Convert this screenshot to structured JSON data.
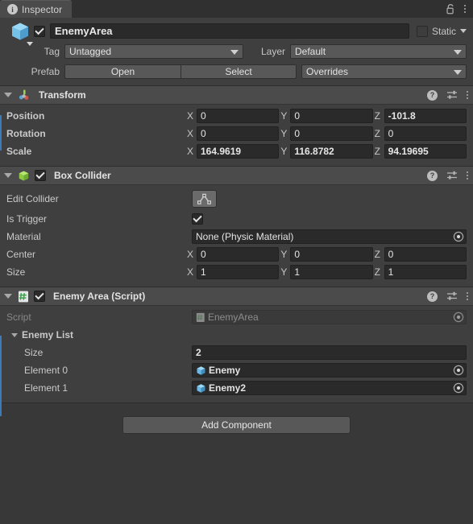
{
  "window": {
    "tab_label": "Inspector",
    "tab_icon": "info-icon",
    "lock_icon": "lock-open-icon",
    "menu_icon": "kebab-menu-icon"
  },
  "gameobject": {
    "icon": "cube-icon",
    "enabled": true,
    "name": "EnemyArea",
    "static_checked": false,
    "static_label": "Static",
    "tag_label": "Tag",
    "tag_value": "Untagged",
    "layer_label": "Layer",
    "layer_value": "Default",
    "prefab_label": "Prefab",
    "prefab_open": "Open",
    "prefab_select": "Select",
    "prefab_overrides": "Overrides"
  },
  "components": [
    {
      "id": "transform",
      "title": "Transform",
      "icon": "transform-axis-icon",
      "has_enable_checkbox": false,
      "help_icon": "help-icon",
      "preset_icon": "preset-icon",
      "menu_icon": "kebab-menu-icon",
      "rows": [
        {
          "label": "Position",
          "type": "vector3",
          "x": "0",
          "y": "0",
          "z": "-101.8",
          "bold_values": false
        },
        {
          "label": "Rotation",
          "type": "vector3",
          "x": "0",
          "y": "0",
          "z": "0",
          "bold_values": false
        },
        {
          "label": "Scale",
          "type": "vector3",
          "x": "164.9619",
          "y": "116.8782",
          "z": "94.19695",
          "bold_values": true
        }
      ]
    },
    {
      "id": "box-collider",
      "title": "Box Collider",
      "icon": "green-cube-icon",
      "has_enable_checkbox": true,
      "enabled": true,
      "help_icon": "help-icon",
      "preset_icon": "preset-icon",
      "menu_icon": "kebab-menu-icon",
      "rows": [
        {
          "label": "Edit Collider",
          "type": "button",
          "button_icon": "edit-collider-icon"
        },
        {
          "label": "Is Trigger",
          "type": "checkbox",
          "checked": true
        },
        {
          "label": "Material",
          "type": "object",
          "value": "None (Physic Material)",
          "icon": null,
          "picker": "object-picker-icon"
        },
        {
          "label": "Center",
          "type": "vector3",
          "x": "0",
          "y": "0",
          "z": "0",
          "bold_values": false
        },
        {
          "label": "Size",
          "type": "vector3",
          "x": "1",
          "y": "1",
          "z": "1",
          "bold_values": false
        }
      ]
    },
    {
      "id": "enemy-area-script",
      "title": "Enemy Area (Script)",
      "icon": "script-icon",
      "has_enable_checkbox": true,
      "enabled": true,
      "help_icon": "help-icon",
      "preset_icon": "preset-icon",
      "menu_icon": "kebab-menu-icon",
      "rows": [
        {
          "label": "Script",
          "type": "object",
          "value": "EnemyArea",
          "icon": "script-chip-icon",
          "picker": "object-picker-icon",
          "disabled": true
        },
        {
          "label": "Enemy List",
          "type": "foldout",
          "expanded": true
        },
        {
          "label": "Size",
          "type": "text",
          "value": "2"
        },
        {
          "label": "Element 0",
          "type": "object",
          "value": "Enemy",
          "icon": "prefab-cube-icon",
          "picker": "object-picker-icon"
        },
        {
          "label": "Element 1",
          "type": "object",
          "value": "Enemy2",
          "icon": "prefab-cube-icon",
          "picker": "object-picker-icon"
        }
      ]
    }
  ],
  "footer": {
    "add_component_label": "Add Component"
  },
  "colors": {
    "background": "#383838",
    "panel": "#3f3f3f",
    "header": "#4b4b4b",
    "field": "#2a2a2a",
    "override_blue": "#3e7ab8",
    "accent_cube_blue": "#6cb9e8",
    "accent_green": "#8fd14f"
  }
}
